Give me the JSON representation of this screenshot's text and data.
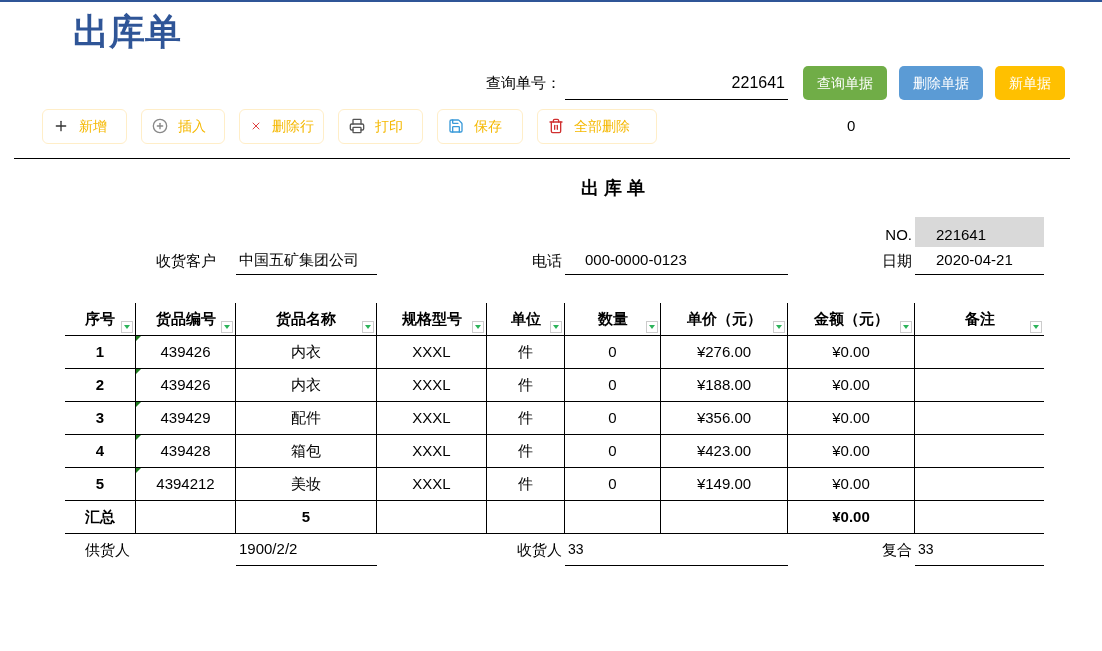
{
  "title": "出库单",
  "query": {
    "label": "查询单号：",
    "value": "221641"
  },
  "actions": [
    {
      "label": "查询单据",
      "color": "#70ad47"
    },
    {
      "label": "删除单据",
      "color": "#5b9bd5"
    },
    {
      "label": "新单据",
      "color": "#ffc000"
    }
  ],
  "toolbar": [
    {
      "label": "新增",
      "kind": "add"
    },
    {
      "label": "插入",
      "kind": "insert"
    },
    {
      "label": "删除行",
      "kind": "delete"
    },
    {
      "label": "打印",
      "kind": "print"
    },
    {
      "label": "保存",
      "kind": "save"
    },
    {
      "label": "全部删除",
      "kind": "clear"
    }
  ],
  "counter": "0",
  "sheet": {
    "title": "出 库 单",
    "no_label": "NO.",
    "no_value": "221641",
    "customer_label": "收货客户",
    "customer": "中国五矿集团公司",
    "phone_label": "电话",
    "phone": "000-0000-0123",
    "date_label": "日期",
    "date": "2020-04-21"
  },
  "table": {
    "columns": [
      {
        "label": "序号",
        "filter": true
      },
      {
        "label": "货品编号",
        "filter": true
      },
      {
        "label": "货品名称",
        "filter": true
      },
      {
        "label": "规格型号",
        "filter": true
      },
      {
        "label": "单位",
        "filter": true
      },
      {
        "label": "数量",
        "filter": true
      },
      {
        "label": "单价（元）",
        "filter": true
      },
      {
        "label": "金额（元）",
        "filter": true
      },
      {
        "label": "备注",
        "filter": true
      }
    ],
    "rows": [
      {
        "flagged": true,
        "cells": [
          "1",
          "439426",
          "内衣",
          "XXXL",
          "件",
          "0",
          "¥276.00",
          "¥0.00",
          null
        ]
      },
      {
        "flagged": true,
        "cells": [
          "2",
          "439426",
          "内衣",
          "XXXL",
          "件",
          "0",
          "¥188.00",
          "¥0.00",
          null
        ]
      },
      {
        "flagged": true,
        "cells": [
          "3",
          "439429",
          "配件",
          "XXXL",
          "件",
          "0",
          "¥356.00",
          "¥0.00",
          null
        ]
      },
      {
        "flagged": true,
        "cells": [
          "4",
          "439428",
          "箱包",
          "XXXL",
          "件",
          "0",
          "¥423.00",
          "¥0.00",
          null
        ]
      },
      {
        "flagged": true,
        "cells": [
          "5",
          "4394212",
          "美妆",
          "XXXL",
          "件",
          "0",
          "¥149.00",
          "¥0.00",
          null
        ]
      }
    ],
    "total": {
      "label": "汇总",
      "name_count": "5",
      "amount": "¥0.00"
    }
  },
  "footer": {
    "supplier_label": "供货人",
    "supplier": "1900/2/2",
    "receiver_label": "收货人",
    "receiver": "33",
    "checker_label": "复合",
    "checker": "33"
  }
}
